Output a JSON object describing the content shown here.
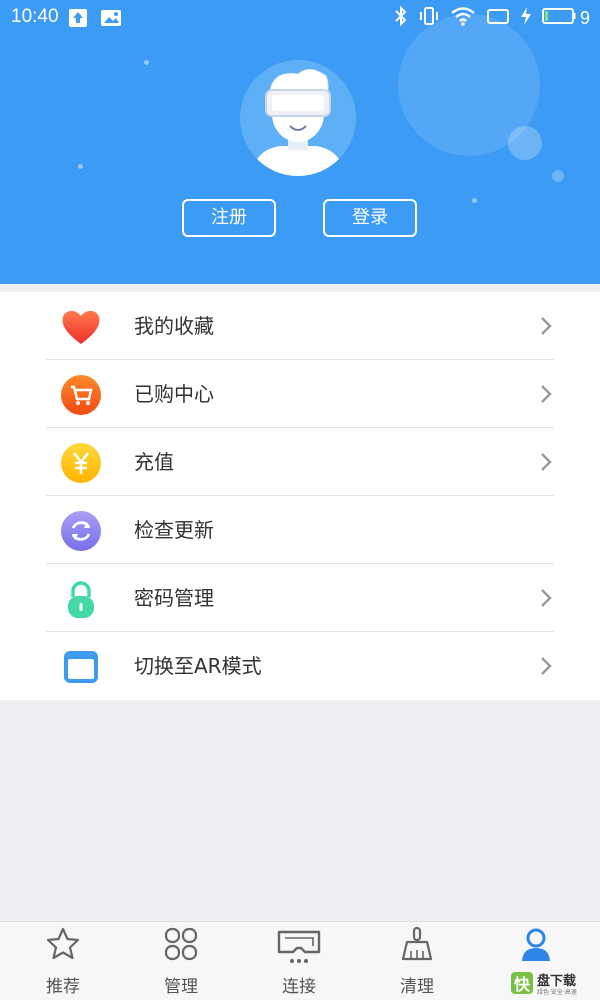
{
  "status_bar": {
    "time": "10:40",
    "battery_level": "9",
    "icons": [
      "upload-icon",
      "image-icon",
      "bluetooth-icon",
      "vibrate-icon",
      "wifi-icon",
      "battery-icon"
    ]
  },
  "colors": {
    "header_bg": "#3c9bf5",
    "menu_text": "#333333",
    "nav_active": "#2b86e8"
  },
  "profile": {
    "register_label": "注册",
    "login_label": "登录"
  },
  "menu": {
    "items": [
      {
        "label": "我的收藏",
        "icon": "heart-icon",
        "has_arrow": true
      },
      {
        "label": "已购中心",
        "icon": "cart-icon",
        "has_arrow": true
      },
      {
        "label": "充值",
        "icon": "yuan-coin-icon",
        "has_arrow": true
      },
      {
        "label": "检查更新",
        "icon": "refresh-icon",
        "has_arrow": false
      },
      {
        "label": "密码管理",
        "icon": "lock-icon",
        "has_arrow": true
      },
      {
        "label": "切换至AR模式",
        "icon": "window-icon",
        "has_arrow": true
      }
    ]
  },
  "bottom_nav": {
    "items": [
      {
        "label": "推荐",
        "icon": "star-icon",
        "active": false
      },
      {
        "label": "管理",
        "icon": "grid-icon",
        "active": false
      },
      {
        "label": "连接",
        "icon": "vr-headset-icon",
        "active": false
      },
      {
        "label": "清理",
        "icon": "broom-icon",
        "active": false
      },
      {
        "label": "",
        "icon": "user-icon",
        "active": true
      }
    ]
  },
  "watermark": {
    "logo_text": "快盘下载",
    "tagline": "绿色·安全·高速"
  }
}
